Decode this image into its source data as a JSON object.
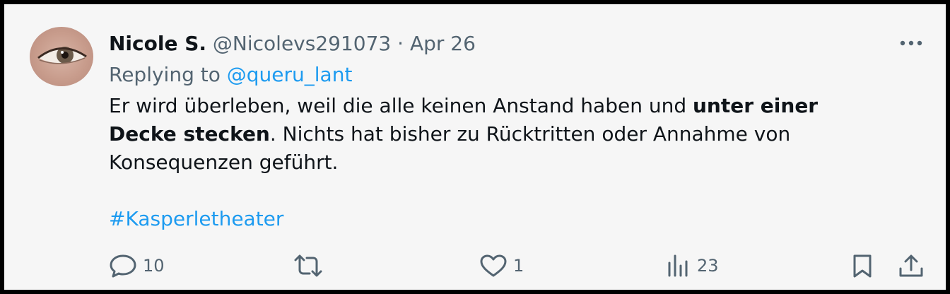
{
  "tweet": {
    "author_name": "Nicole S.",
    "handle": "@Nicolevs291073",
    "separator": "·",
    "date": "Apr 26",
    "replying_prefix": "Replying to",
    "replying_handle": "@queru_lant",
    "text_part1": "Er wird überleben, weil die alle keinen Anstand haben und ",
    "text_bold": "unter einer Decke stecken",
    "text_part2": ". Nichts hat bisher zu Rücktritten oder Annahme von Konsequenzen geführt.",
    "hashtag": "#Kasperletheater"
  },
  "actions": {
    "replies": "10",
    "likes": "1",
    "views": "23"
  },
  "icons": [
    "avatar",
    "more-icon",
    "reply-icon",
    "retweet-icon",
    "like-icon",
    "views-icon",
    "bookmark-icon",
    "share-icon"
  ],
  "colors": {
    "text_primary": "#0f1419",
    "text_secondary": "#536471",
    "link": "#1d9bf0",
    "background": "#f6f6f6",
    "border": "#000000"
  }
}
